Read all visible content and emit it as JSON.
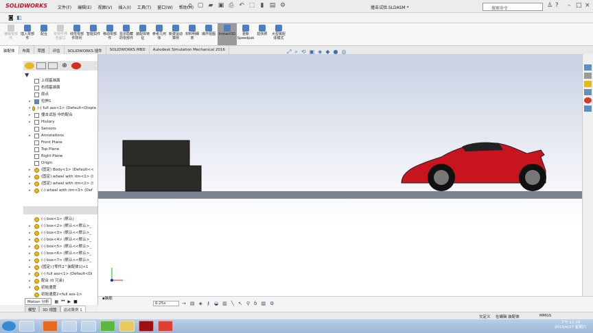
{
  "app": {
    "logo": "SOLIDWORKS",
    "title": "撞击试验.SLDASM *"
  },
  "menu": [
    "文件(F)",
    "编辑(E)",
    "视图(V)",
    "插入(I)",
    "工具(T)",
    "窗口(W)",
    "帮助(H)"
  ],
  "search": {
    "placeholder": "搜索命令"
  },
  "ribbon": [
    {
      "label": "编辑零部件",
      "state": "disabled"
    },
    {
      "label": "插入零部件",
      "state": "normal"
    },
    {
      "label": "配合",
      "state": "normal"
    },
    {
      "label": "零部件预览窗口",
      "state": "disabled"
    },
    {
      "label": "线性零部件阵列",
      "state": "normal"
    },
    {
      "label": "智能扣件",
      "state": "normal"
    },
    {
      "label": "移动零部件",
      "state": "normal"
    },
    {
      "label": "显示隐藏的零部件",
      "state": "normal"
    },
    {
      "label": "装配体特征",
      "state": "normal"
    },
    {
      "label": "参考几何体",
      "state": "normal"
    },
    {
      "label": "新建运动算例",
      "state": "normal"
    },
    {
      "label": "材料明细表",
      "state": "normal"
    },
    {
      "label": "爆炸视图",
      "state": "normal"
    },
    {
      "label": "Instant3D",
      "state": "selected"
    },
    {
      "label": "更新Speedpak",
      "state": "normal"
    },
    {
      "label": "拍快照",
      "state": "normal"
    },
    {
      "label": "大型装配体模式",
      "state": "normal"
    }
  ],
  "tabs": [
    "装配体",
    "布局",
    "草图",
    "评估",
    "SOLIDWORKS 插件",
    "SOLIDWORKS MBD",
    "Autodesk Simulation Mechanical 2016"
  ],
  "feature_tree": [
    {
      "label": "上视基准面",
      "indent": 1,
      "icon": "plane"
    },
    {
      "label": "右视基准面",
      "indent": 1,
      "icon": "plane"
    },
    {
      "label": "原点",
      "indent": 1,
      "icon": "origin"
    },
    {
      "label": "拉伸1",
      "indent": 1,
      "icon": "feature",
      "arrow": "▸"
    },
    {
      "label": "(-) full ass<1> (Default<Displa",
      "indent": 0,
      "icon": "assembly",
      "arrow": "▾"
    },
    {
      "label": "撞击试验 中的配合",
      "indent": 1,
      "icon": "folder",
      "arrow": "▸"
    },
    {
      "label": "History",
      "indent": 1,
      "icon": "folder",
      "arrow": "▸"
    },
    {
      "label": "Sensors",
      "indent": 1,
      "icon": "folder"
    },
    {
      "label": "Annotations",
      "indent": 1,
      "icon": "folder",
      "arrow": "▸"
    },
    {
      "label": "Front Plane",
      "indent": 1,
      "icon": "plane"
    },
    {
      "label": "Top Plane",
      "indent": 1,
      "icon": "plane"
    },
    {
      "label": "Right Plane",
      "indent": 1,
      "icon": "plane"
    },
    {
      "label": "Origin",
      "indent": 1,
      "icon": "origin"
    },
    {
      "label": "(固定) Body<1> (Default<<",
      "indent": 1,
      "icon": "part",
      "arrow": "▸"
    },
    {
      "label": "(固定) wheel with rim<1> (I",
      "indent": 1,
      "icon": "part",
      "arrow": "▸"
    },
    {
      "label": "(固定) wheel with rim<2> (I",
      "indent": 1,
      "icon": "part",
      "arrow": "▸"
    },
    {
      "label": "(-) wheel with rim<3> (Def",
      "indent": 1,
      "icon": "part",
      "arrow": "▸"
    }
  ],
  "motion_tree": [
    {
      "label": "(-) box<1> (默认)",
      "arrow": ""
    },
    {
      "label": "(-) box<2> (默认<<默认>_",
      "arrow": "▸"
    },
    {
      "label": "(-) box<3> (默认<<默认>_",
      "arrow": "▸"
    },
    {
      "label": "(-) box<4> (默认<<默认>_",
      "arrow": "▸"
    },
    {
      "label": "(-) box<5> (默认<<默认>_",
      "arrow": "▸"
    },
    {
      "label": "(-) box<6> (默认<<默认>_",
      "arrow": "▸"
    },
    {
      "label": "(-) box<7> (默认<<默认>_",
      "arrow": "▸"
    },
    {
      "label": "(固定) [零件2^装配体1]<1",
      "arrow": "▸"
    },
    {
      "label": "(-) full ass<1> (Default<Di",
      "arrow": "▸"
    },
    {
      "label": "配合 (0 冗余)",
      "arrow": "▸"
    },
    {
      "label": "初始速度",
      "arrow": "▾"
    },
    {
      "label": "初始速度2<full ass-1>",
      "arrow": ""
    }
  ],
  "motion": {
    "type": "Motion 分析",
    "zoom": "0.25x",
    "label": "▪脑筋"
  },
  "bottom_tabs": [
    "模型",
    "3D 视图",
    "运动算例 1"
  ],
  "status": {
    "state": "欠定义",
    "editing": "在编辑 装配体",
    "units": "MMGS"
  },
  "clock": {
    "time": "下午 11:26",
    "date": "2019/4/27 星期六"
  },
  "colors": {
    "car": "#c8141e",
    "box": "#2d2b28",
    "ground": "#7c8392"
  }
}
